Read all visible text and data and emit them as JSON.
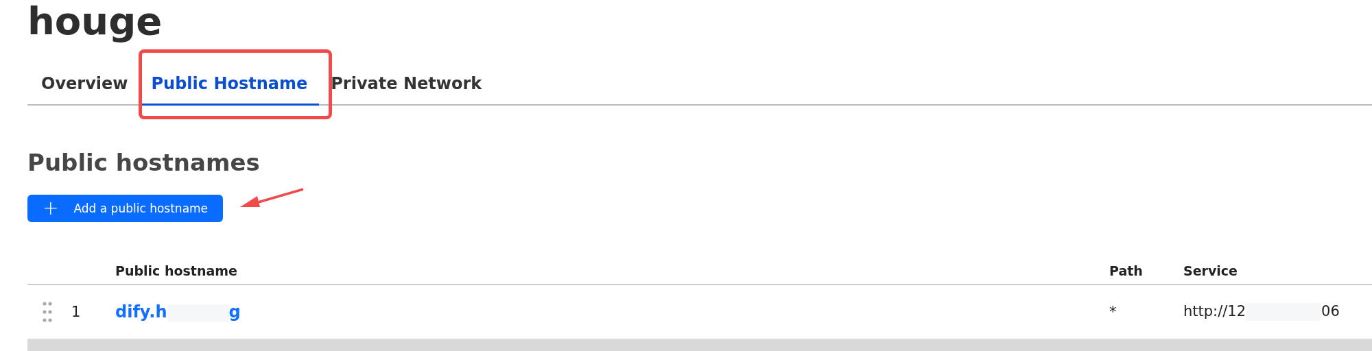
{
  "title": "houge",
  "tabs": [
    {
      "label": "Overview",
      "selected": false
    },
    {
      "label": "Public Hostname",
      "selected": true
    },
    {
      "label": "Private Network",
      "selected": false
    }
  ],
  "section": {
    "heading": "Public hostnames",
    "add_button": {
      "icon": "+",
      "label": "Add a public hostname"
    }
  },
  "table": {
    "columns": [
      "Public hostname",
      "Path",
      "Service"
    ],
    "rows": [
      {
        "index": "1",
        "hostname": {
          "before": "dify.h",
          "after": "g",
          "redacted": true
        },
        "path": "*",
        "service": {
          "before": "http://12",
          "after": "06",
          "redacted": true
        }
      }
    ]
  }
}
